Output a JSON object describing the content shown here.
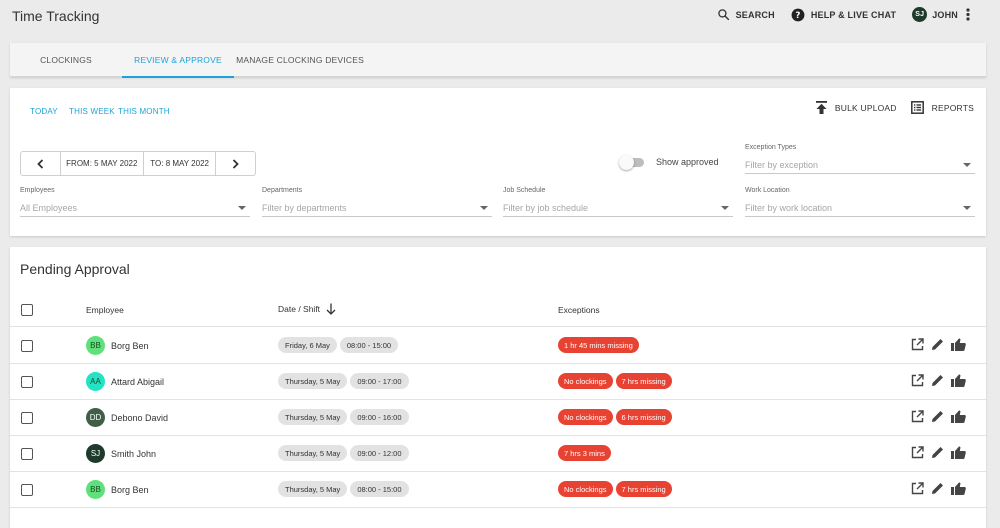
{
  "app": {
    "title": "Time Tracking",
    "search_label": "SEARCH",
    "help_label": "HELP & LIVE CHAT",
    "user_initials": "SJ",
    "user_name": "JOHN"
  },
  "tabs": [
    {
      "label": "CLOCKINGS",
      "active": false
    },
    {
      "label": "REVIEW & APPROVE",
      "active": true
    },
    {
      "label": "MANAGE CLOCKING DEVICES",
      "active": false
    }
  ],
  "filters": {
    "quick": [
      "TODAY",
      "THIS WEEK",
      "THIS MONTH"
    ],
    "bulk_upload_label": "BULK UPLOAD",
    "reports_label": "REPORTS",
    "date_from": "FROM: 5 MAY 2022",
    "date_to": "TO: 8 MAY 2022",
    "show_approved_label": "Show approved",
    "show_approved": false,
    "exception_types": {
      "label": "Exception Types",
      "placeholder": "Filter by exception"
    },
    "employees": {
      "label": "Employees",
      "placeholder": "All Employees"
    },
    "departments": {
      "label": "Departments",
      "placeholder": "Filter by departments"
    },
    "job_schedule": {
      "label": "Job Schedule",
      "placeholder": "Filter by job schedule"
    },
    "work_location": {
      "label": "Work Location",
      "placeholder": "Filter by work location"
    }
  },
  "table": {
    "title": "Pending Approval",
    "columns": {
      "employee": "Employee",
      "date_shift": "Date / Shift",
      "exceptions": "Exceptions"
    },
    "rows": [
      {
        "initials": "BB",
        "name": "Borg Ben",
        "avatar_color": "#5ee07a",
        "date": "Friday, 6 May",
        "shift": "08:00 - 15:00",
        "exceptions": [
          "1 hr 45 mins missing"
        ]
      },
      {
        "initials": "AA",
        "name": "Attard Abigail",
        "avatar_color": "#22e3c4",
        "date": "Thursday, 5 May",
        "shift": "09:00 - 17:00",
        "exceptions": [
          "No clockings",
          "7 hrs missing"
        ]
      },
      {
        "initials": "DD",
        "name": "Debono David",
        "avatar_color": "#3f5f46",
        "date": "Thursday, 5 May",
        "shift": "09:00 - 16:00",
        "exceptions": [
          "No clockings",
          "6 hrs missing"
        ]
      },
      {
        "initials": "SJ",
        "name": "Smith John",
        "avatar_color": "#1d3a2b",
        "date": "Thursday, 5 May",
        "shift": "09:00 - 12:00",
        "exceptions": [
          "7 hrs 3 mins"
        ]
      },
      {
        "initials": "BB",
        "name": "Borg Ben",
        "avatar_color": "#5ee07a",
        "date": "Thursday, 5 May",
        "shift": "08:00 - 15:00",
        "exceptions": [
          "No clockings",
          "7 hrs missing"
        ]
      }
    ]
  },
  "colors": {
    "accent": "#1ea3d6",
    "exception": "#e84233"
  }
}
